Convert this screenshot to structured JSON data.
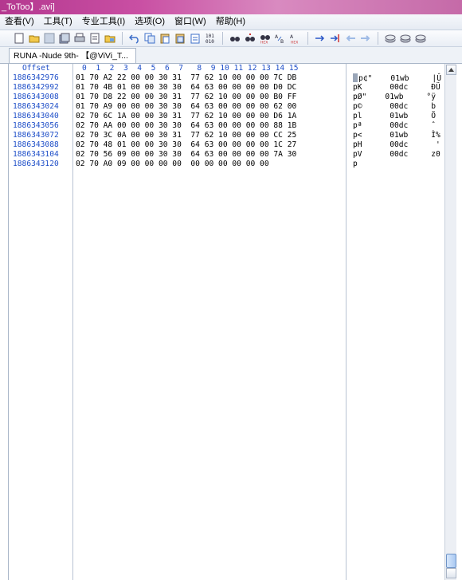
{
  "window": {
    "title": "_ToToo】.avi]"
  },
  "menu": [
    "查看(V)",
    "工具(T)",
    "专业工具(I)",
    "选项(O)",
    "窗口(W)",
    "帮助(H)"
  ],
  "toolbar_icons": [
    "new-file-icon",
    "open-folder-icon",
    "save-icon",
    "save-all-icon",
    "print-icon",
    "properties-icon",
    "open-disk-icon",
    "undo-icon",
    "copy-icon",
    "paste-icon",
    "paste-special-icon",
    "clipboard-icon",
    "hex-convert-icon",
    "find-icon",
    "find-next-icon",
    "find-hex-icon",
    "replace-icon",
    "replace-hex-icon",
    "goto-icon",
    "goto-offset-icon",
    "back-icon",
    "forward-icon",
    "disk-icon",
    "disk-2-icon",
    "disk-3-icon"
  ],
  "tab": {
    "label": "RUNA -Nude 9th- 【@ViVi_T..."
  },
  "columns": {
    "offset_header": "Offset",
    "hex_header": "0  1  2  3  4  5  6  7   8  9 10 11 12 13 14 15"
  },
  "rows": [
    {
      "offset": "1886342976",
      "hex": "01 70 A2 22 00 00 30 31  77 62 10 00 00 00 7C DB",
      "ascii": "p¢\"    01wb     |Û"
    },
    {
      "offset": "1886342992",
      "hex": "01 70 4B 01 00 00 30 30  64 63 00 00 00 00 D0 DC",
      "ascii": "pK      00dc     ÐÜ"
    },
    {
      "offset": "1886343008",
      "hex": "01 70 D8 22 00 00 30 31  77 62 10 00 00 00 B0 FF",
      "ascii": "pØ\"    01wb     °ÿ"
    },
    {
      "offset": "1886343024",
      "hex": "01 70 A9 00 00 00 30 30  64 63 00 00 00 00 62 00",
      "ascii": "p©      00dc     b"
    },
    {
      "offset": "1886343040",
      "hex": "02 70 6C 1A 00 00 30 31  77 62 10 00 00 00 D6 1A",
      "ascii": "pl      01wb     Ö"
    },
    {
      "offset": "1886343056",
      "hex": "02 70 AA 00 00 00 30 30  64 63 00 00 00 00 88 1B",
      "ascii": "pª      00dc     ˆ"
    },
    {
      "offset": "1886343072",
      "hex": "02 70 3C 0A 00 00 30 31  77 62 10 00 00 00 CC 25",
      "ascii": "p<      01wb     Ì%"
    },
    {
      "offset": "1886343088",
      "hex": "02 70 48 01 00 00 30 30  64 63 00 00 00 00 1C 27",
      "ascii": "pH      00dc      '"
    },
    {
      "offset": "1886343104",
      "hex": "02 70 56 09 00 00 30 30  64 63 00 00 00 00 7A 30",
      "ascii": "pV      00dc     z0"
    },
    {
      "offset": "1886343120",
      "hex": "02 70 A0 09 00 00 00 00  00 00 00 00 00 00",
      "ascii": "p"
    }
  ]
}
